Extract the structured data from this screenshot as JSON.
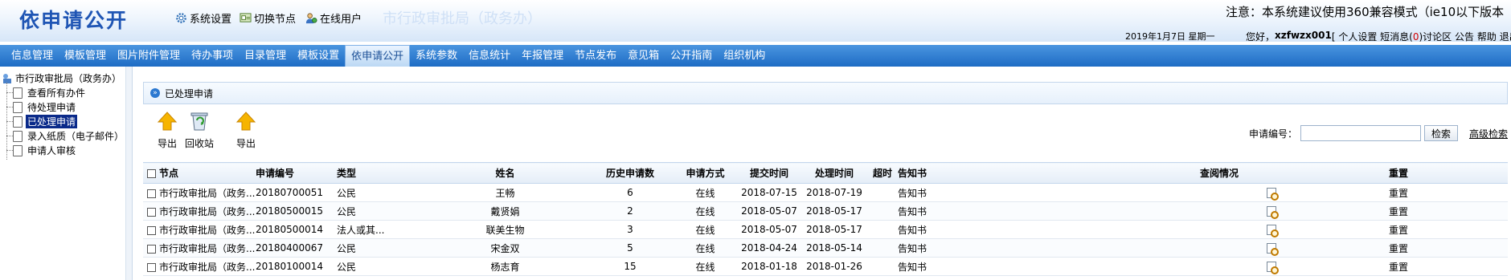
{
  "header": {
    "app_title": "依申请公开",
    "links": [
      {
        "label": "系统设置",
        "icon": "gear-icon"
      },
      {
        "label": "切换节点",
        "icon": "switch-node-icon"
      },
      {
        "label": "在线用户",
        "icon": "online-users-icon"
      }
    ],
    "org_title": "市行政审批局（政务办）",
    "notice": "注意：本系统建议使用360兼容模式（ie10以下版本",
    "date": "2019年1月7日 星期一",
    "greeting_prefix": "您好，",
    "username": "xzfwzx001",
    "personal_settings": "[ 个人设置",
    "sms_label": "短消息(",
    "sms_count": "0",
    "sms_suffix": ")",
    "forum": "讨论区",
    "announcement": "公告",
    "help": "帮助",
    "logout": "退出"
  },
  "nav": {
    "items": [
      "信息管理",
      "模板管理",
      "图片附件管理",
      "待办事项",
      "目录管理",
      "模板设置",
      "依申请公开",
      "系统参数",
      "信息统计",
      "年报管理",
      "节点发布",
      "意见箱",
      "公开指南",
      "组织机构"
    ],
    "active_index": 6
  },
  "sidebar": {
    "root": "市行政审批局（政务办）",
    "items": [
      "查看所有办件",
      "待处理申请",
      "已处理申请",
      "录入纸质（电子邮件）",
      "申请人审核"
    ],
    "selected_index": 2
  },
  "main": {
    "breadcrumb": "已处理申请",
    "toolbar": {
      "export1": "导出",
      "recycle": "回收站",
      "export2": "导出"
    },
    "search": {
      "label": "申请编号：",
      "value": "",
      "button": "检索",
      "advanced": "高级检索"
    },
    "table": {
      "columns": [
        "节点",
        "申请编号",
        "类型",
        "姓名",
        "历史申请数",
        "申请方式",
        "提交时间",
        "处理时间",
        "超时",
        "告知书",
        "查阅情况",
        "重置"
      ],
      "rows": [
        [
          "市行政审批局（政务...",
          "20180700051",
          "公民",
          "王畅",
          "6",
          "在线",
          "2018-07-15",
          "2018-07-19",
          "",
          "告知书",
          "",
          "重置"
        ],
        [
          "市行政审批局（政务...",
          "20180500015",
          "公民",
          "戴贤娟",
          "2",
          "在线",
          "2018-05-07",
          "2018-05-17",
          "",
          "告知书",
          "",
          "重置"
        ],
        [
          "市行政审批局（政务...",
          "20180500014",
          "法人或其...",
          "联美生物",
          "3",
          "在线",
          "2018-05-07",
          "2018-05-17",
          "",
          "告知书",
          "",
          "重置"
        ],
        [
          "市行政审批局（政务...",
          "20180400067",
          "公民",
          "宋金双",
          "5",
          "在线",
          "2018-04-24",
          "2018-05-14",
          "",
          "告知书",
          "",
          "重置"
        ],
        [
          "市行政审批局（政务...",
          "20180100014",
          "公民",
          "杨志育",
          "15",
          "在线",
          "2018-01-18",
          "2018-01-26",
          "",
          "告知书",
          "",
          "重置"
        ]
      ]
    }
  },
  "colors": {
    "title_blue": "#1f55b4",
    "nav_blue": "#2a7bd2",
    "selected_tree": "#0a2a8a",
    "sms_red": "#d00000"
  }
}
